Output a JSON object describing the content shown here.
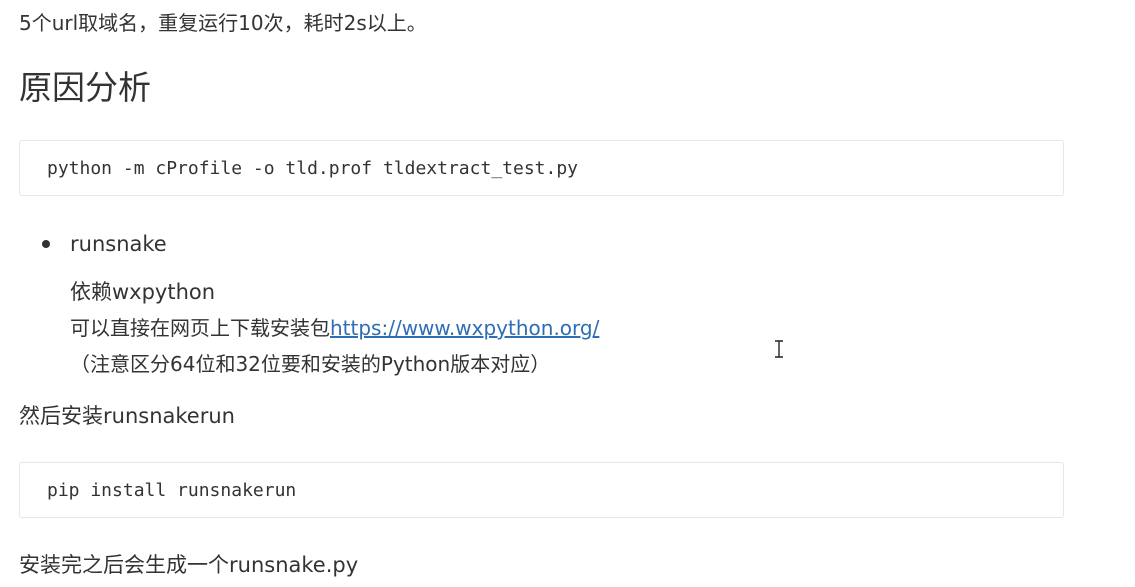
{
  "intro_text": "5个url取域名，重复运行10次，耗时2s以上。",
  "section_heading": "原因分析",
  "code_blocks": [
    "python -m cProfile -o tld.prof tldextract_test.py",
    "pip install runsnakerun"
  ],
  "bullet": {
    "title": "runsnake",
    "dependency": "依赖wxpython",
    "download_prefix": "可以直接在网页上下载安装包",
    "download_link": "https://www.wxpython.org/",
    "download_suffix": "（注意区分64位和32位要和安装的Python版本对应）"
  },
  "then_text": "然后安装runsnakerun",
  "after_text": "安装完之后会生成一个runsnake.py",
  "colors": {
    "text": "#333333",
    "link": "#2f6db5",
    "code_border": "#e6e6e6"
  },
  "cursor_icon": "text-cursor-icon"
}
